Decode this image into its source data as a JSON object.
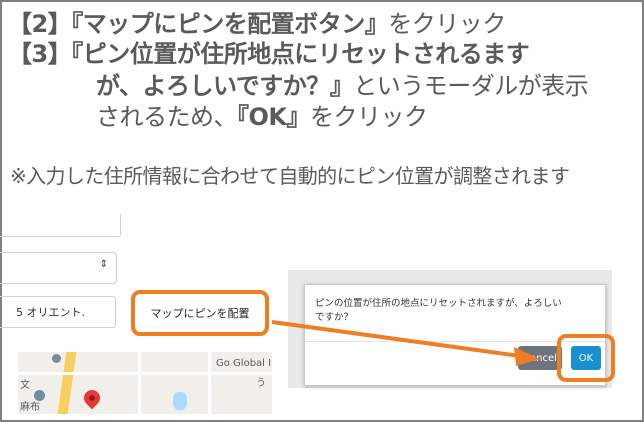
{
  "instructions": {
    "line1_step": "【2】",
    "line1_bold": "『マップにピンを配置ボタン』",
    "line1_rest": "をクリック",
    "line2_step": "【3】",
    "line2_bold": "『ピン位置が住所地点にリセットされるます",
    "line3_bold": "が、よろしいですか？』",
    "line3_rest": "というモーダルが表示",
    "line4_pre": "されるため、",
    "line4_bold": "『OK』",
    "line4_rest": "をクリック"
  },
  "note": "※入力した住所情報に合わせて自動的にピン位置が調整されます",
  "form": {
    "address_value": "5 オリエント.",
    "select_caret": "⇕"
  },
  "pin_button": {
    "label": "マップにピンを配置"
  },
  "map": {
    "labels": [
      "Go Global I",
      "文",
      "麻布",
      "う"
    ]
  },
  "modal": {
    "message": "ピンの位置が住所の地点にリセットされますが、よろしいですか？",
    "cancel_label": "Cancel",
    "ok_label": "OK"
  },
  "colors": {
    "highlight": "#ef7d22",
    "ok_button": "#1a8fd0",
    "cancel_button": "#6c757d"
  }
}
